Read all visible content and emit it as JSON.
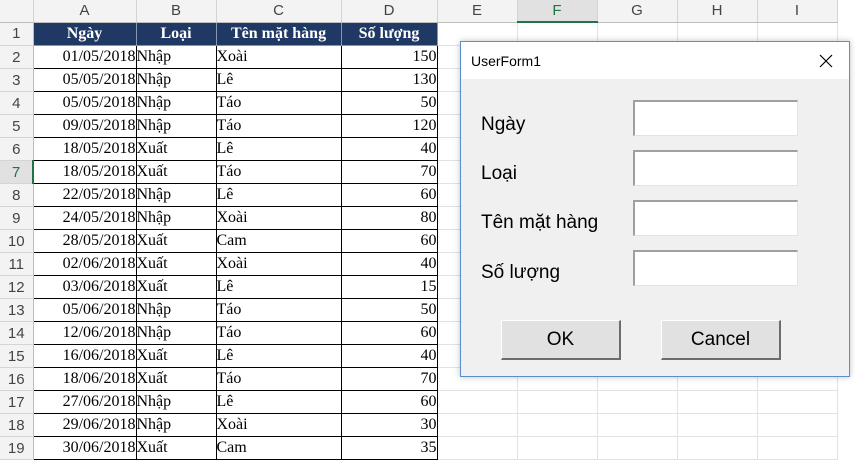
{
  "columns": [
    "A",
    "B",
    "C",
    "D",
    "E",
    "F",
    "G",
    "H",
    "I"
  ],
  "header": {
    "ngay": "Ngày",
    "loai": "Loại",
    "ten": "Tên mặt hàng",
    "soluong": "Số lượng"
  },
  "rows": [
    {
      "n": "1",
      "date": "",
      "type": "",
      "item": "",
      "qty": ""
    },
    {
      "n": "2",
      "date": "01/05/2018",
      "type": "Nhập",
      "item": "Xoài",
      "qty": "150"
    },
    {
      "n": "3",
      "date": "05/05/2018",
      "type": "Nhập",
      "item": "Lê",
      "qty": "130"
    },
    {
      "n": "4",
      "date": "05/05/2018",
      "type": "Nhập",
      "item": "Táo",
      "qty": "50"
    },
    {
      "n": "5",
      "date": "09/05/2018",
      "type": "Nhập",
      "item": "Táo",
      "qty": "120"
    },
    {
      "n": "6",
      "date": "18/05/2018",
      "type": "Xuất",
      "item": "Lê",
      "qty": "40"
    },
    {
      "n": "7",
      "date": "18/05/2018",
      "type": "Xuất",
      "item": "Táo",
      "qty": "70"
    },
    {
      "n": "8",
      "date": "22/05/2018",
      "type": "Nhập",
      "item": "Lê",
      "qty": "60"
    },
    {
      "n": "9",
      "date": "24/05/2018",
      "type": "Nhập",
      "item": "Xoài",
      "qty": "80"
    },
    {
      "n": "10",
      "date": "28/05/2018",
      "type": "Xuất",
      "item": "Cam",
      "qty": "60"
    },
    {
      "n": "11",
      "date": "02/06/2018",
      "type": "Xuất",
      "item": "Xoài",
      "qty": "40"
    },
    {
      "n": "12",
      "date": "03/06/2018",
      "type": "Xuất",
      "item": "Lê",
      "qty": "15"
    },
    {
      "n": "13",
      "date": "05/06/2018",
      "type": "Nhập",
      "item": "Táo",
      "qty": "50"
    },
    {
      "n": "14",
      "date": "12/06/2018",
      "type": "Nhập",
      "item": "Táo",
      "qty": "60"
    },
    {
      "n": "15",
      "date": "16/06/2018",
      "type": "Xuất",
      "item": "Lê",
      "qty": "40"
    },
    {
      "n": "16",
      "date": "18/06/2018",
      "type": "Xuất",
      "item": "Táo",
      "qty": "70"
    },
    {
      "n": "17",
      "date": "27/06/2018",
      "type": "Nhập",
      "item": "Lê",
      "qty": "60"
    },
    {
      "n": "18",
      "date": "29/06/2018",
      "type": "Nhập",
      "item": "Xoài",
      "qty": "30"
    },
    {
      "n": "19",
      "date": "30/06/2018",
      "type": "Xuất",
      "item": "Cam",
      "qty": "35"
    }
  ],
  "selected_column": "F",
  "selected_row": "7",
  "dialog": {
    "title": "UserForm1",
    "close_icon": "close-icon",
    "labels": {
      "ngay": "Ngày",
      "loai": "Loại",
      "ten": "Tên mặt hàng",
      "soluong": "Số lượng"
    },
    "values": {
      "ngay": "",
      "loai": "",
      "ten": "",
      "soluong": ""
    },
    "ok_label": "OK",
    "cancel_label": "Cancel"
  }
}
